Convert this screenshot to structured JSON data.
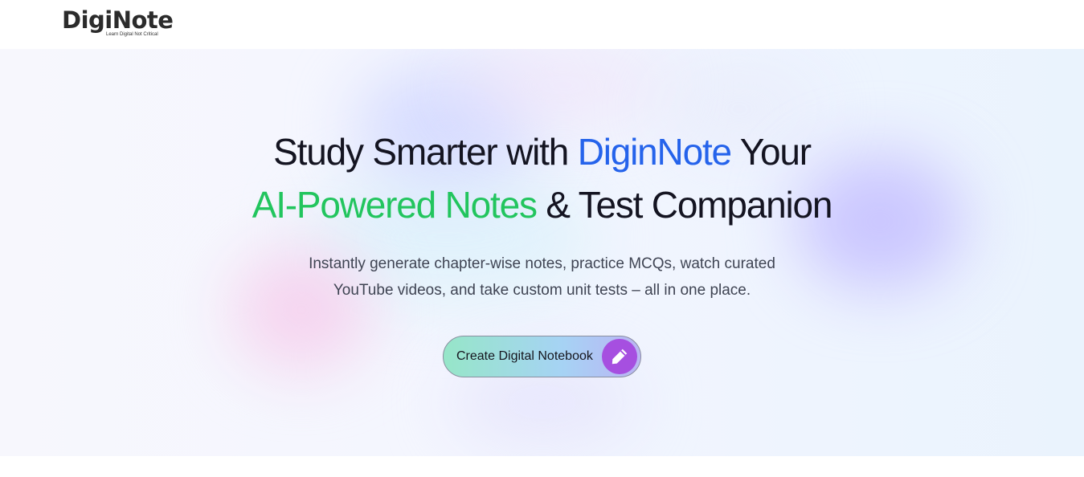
{
  "header": {
    "logo_text": "DigiNote",
    "tagline": "Learn Digital Not Critical"
  },
  "hero": {
    "headline_line1_part1": "Study Smarter with",
    "headline_line1_brand": "DiginNote",
    "headline_line1_part2": "Your",
    "headline_line2_highlight": "AI-Powered Notes",
    "headline_line2_rest": "& Test Companion",
    "subtitle_line1": "Instantly generate chapter-wise notes, practice MCQs, watch curated",
    "subtitle_line2": "YouTube videos, and take custom unit tests – all in one place.",
    "cta_label": "Create Digital Notebook",
    "cta_icon": "pencil-icon"
  },
  "colors": {
    "brand_blue": "#2563eb",
    "accent_green": "#22c55e",
    "heading_dark": "#141421",
    "cta_icon_bg": "#a64fe0"
  }
}
